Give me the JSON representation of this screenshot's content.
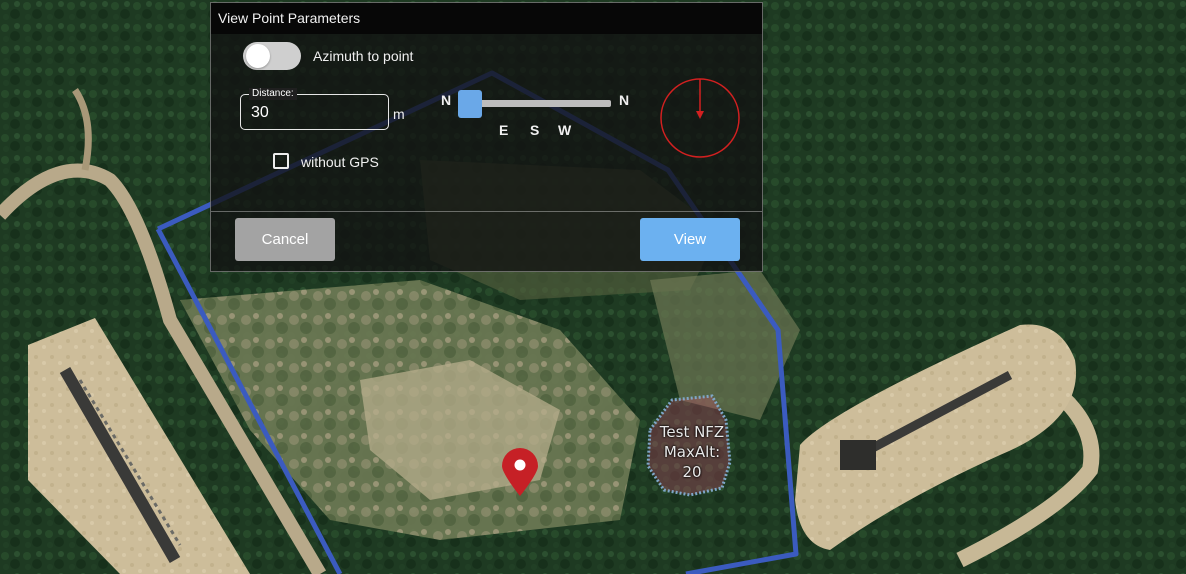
{
  "dialog": {
    "title": "View Point Parameters",
    "azimuth_label": "Azimuth to point",
    "azimuth_enabled": false,
    "distance_label": "Distance:",
    "distance_value": "30",
    "distance_unit": "m",
    "compass": {
      "left": "N",
      "right": "N",
      "ticks": [
        "E",
        "S",
        "W"
      ]
    },
    "azimuth_slider_value": 0,
    "without_gps_label": "without GPS",
    "without_gps_checked": false,
    "cancel_label": "Cancel",
    "view_label": "View"
  },
  "map": {
    "nfz_name": "Test NFZ",
    "nfz_maxalt": "MaxAlt: 20",
    "colors": {
      "route": "#3b5bbf",
      "marker": "#c62026",
      "nfz": "#d04a6a",
      "compass_ring": "#d22020"
    }
  }
}
